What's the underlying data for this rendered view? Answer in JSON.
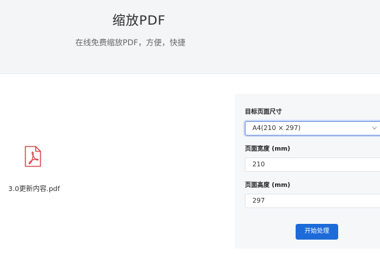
{
  "header": {
    "title": "缩放PDF",
    "subtitle": "在线免费缩放PDF，方便，快捷"
  },
  "file": {
    "name": "3.0更新内容.pdf",
    "icon": "pdf-file-icon"
  },
  "settings": {
    "target_size": {
      "label": "目标页面尺寸",
      "value": "A4(210 × 297)"
    },
    "width": {
      "label": "页面宽度 (mm)",
      "value": "210"
    },
    "height": {
      "label": "页面高度 (mm)",
      "value": "297"
    },
    "submit_label": "开始处理"
  },
  "colors": {
    "accent": "#1d6bd8",
    "pdf_icon": "#d9363e",
    "header_bg": "#f3f5f7"
  }
}
